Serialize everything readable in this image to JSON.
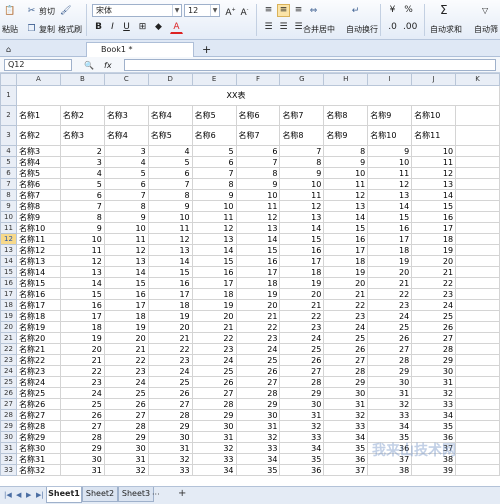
{
  "ribbon": {
    "paste": "粘贴",
    "cut": "剪切",
    "copy": "复制",
    "format_painter": "格式刷",
    "font_name": "宋体",
    "font_size": "12",
    "bold": "B",
    "italic": "I",
    "underline": "U",
    "font_color": "A",
    "merge_center": "合并居中",
    "wrap_text": "自动换行",
    "currency": "¥",
    "percent": "%",
    "autosum": "自动求和",
    "autofilter": "自动筛"
  },
  "tabs": {
    "document": "Book1 *",
    "new_tab": "+"
  },
  "formula_bar": {
    "name_box": "Q12",
    "fx": "fx",
    "formula": ""
  },
  "columns": [
    "A",
    "B",
    "C",
    "D",
    "E",
    "F",
    "G",
    "H",
    "I",
    "J",
    "K"
  ],
  "selected_row": 12,
  "title": "XX表",
  "header_row_2": [
    "名称1",
    "名称2",
    "名称3",
    "名称4",
    "名称5",
    "名称6",
    "名称7",
    "名称8",
    "名称9",
    "名称10"
  ],
  "header_row_3": [
    "名称2",
    "名称3",
    "名称4",
    "名称5",
    "名称6",
    "名称7",
    "名称8",
    "名称9",
    "名称10",
    "名称11"
  ],
  "data_rows": [
    {
      "label": "名称3",
      "values": [
        2,
        3,
        4,
        5,
        6,
        7,
        8,
        9,
        10
      ]
    },
    {
      "label": "名称4",
      "values": [
        3,
        4,
        5,
        6,
        7,
        8,
        9,
        10,
        11
      ]
    },
    {
      "label": "名称5",
      "values": [
        4,
        5,
        6,
        7,
        8,
        9,
        10,
        11,
        12
      ]
    },
    {
      "label": "名称6",
      "values": [
        5,
        6,
        7,
        8,
        9,
        10,
        11,
        12,
        13
      ]
    },
    {
      "label": "名称7",
      "values": [
        6,
        7,
        8,
        9,
        10,
        11,
        12,
        13,
        14
      ]
    },
    {
      "label": "名称8",
      "values": [
        7,
        8,
        9,
        10,
        11,
        12,
        13,
        14,
        15
      ]
    },
    {
      "label": "名称9",
      "values": [
        8,
        9,
        10,
        11,
        12,
        13,
        14,
        15,
        16
      ]
    },
    {
      "label": "名称10",
      "values": [
        9,
        10,
        11,
        12,
        13,
        14,
        15,
        16,
        17
      ]
    },
    {
      "label": "名称11",
      "values": [
        10,
        11,
        12,
        13,
        14,
        15,
        16,
        17,
        18
      ]
    },
    {
      "label": "名称12",
      "values": [
        11,
        12,
        13,
        14,
        15,
        16,
        17,
        18,
        19
      ]
    },
    {
      "label": "名称13",
      "values": [
        12,
        13,
        14,
        15,
        16,
        17,
        18,
        19,
        20
      ]
    },
    {
      "label": "名称14",
      "values": [
        13,
        14,
        15,
        16,
        17,
        18,
        19,
        20,
        21
      ]
    },
    {
      "label": "名称15",
      "values": [
        14,
        15,
        16,
        17,
        18,
        19,
        20,
        21,
        22
      ]
    },
    {
      "label": "名称16",
      "values": [
        15,
        16,
        17,
        18,
        19,
        20,
        21,
        22,
        23
      ]
    },
    {
      "label": "名称17",
      "values": [
        16,
        17,
        18,
        19,
        20,
        21,
        22,
        23,
        24
      ]
    },
    {
      "label": "名称18",
      "values": [
        17,
        18,
        19,
        20,
        21,
        22,
        23,
        24,
        25
      ]
    },
    {
      "label": "名称19",
      "values": [
        18,
        19,
        20,
        21,
        22,
        23,
        24,
        25,
        26
      ]
    },
    {
      "label": "名称20",
      "values": [
        19,
        20,
        21,
        22,
        23,
        24,
        25,
        26,
        27
      ]
    },
    {
      "label": "名称21",
      "values": [
        20,
        21,
        22,
        23,
        24,
        25,
        26,
        27,
        28
      ]
    },
    {
      "label": "名称22",
      "values": [
        21,
        22,
        23,
        24,
        25,
        26,
        27,
        28,
        29
      ]
    },
    {
      "label": "名称23",
      "values": [
        22,
        23,
        24,
        25,
        26,
        27,
        28,
        29,
        30
      ]
    },
    {
      "label": "名称24",
      "values": [
        23,
        24,
        25,
        26,
        27,
        28,
        29,
        30,
        31
      ]
    },
    {
      "label": "名称25",
      "values": [
        24,
        25,
        26,
        27,
        28,
        29,
        30,
        31,
        32
      ]
    },
    {
      "label": "名称26",
      "values": [
        25,
        26,
        27,
        28,
        29,
        30,
        31,
        32,
        33
      ]
    },
    {
      "label": "名称27",
      "values": [
        26,
        27,
        28,
        29,
        30,
        31,
        32,
        33,
        34
      ]
    },
    {
      "label": "名称28",
      "values": [
        27,
        28,
        29,
        30,
        31,
        32,
        33,
        34,
        35
      ]
    },
    {
      "label": "名称29",
      "values": [
        28,
        29,
        30,
        31,
        32,
        33,
        34,
        35,
        36
      ]
    },
    {
      "label": "名称30",
      "values": [
        29,
        30,
        31,
        32,
        33,
        34,
        35,
        36,
        37
      ]
    },
    {
      "label": "名称31",
      "values": [
        30,
        31,
        32,
        33,
        34,
        35,
        36,
        37,
        38
      ]
    },
    {
      "label": "名称32",
      "values": [
        31,
        32,
        33,
        34,
        35,
        36,
        37,
        38,
        39
      ]
    }
  ],
  "sheets": [
    "Sheet1",
    "Sheet2",
    "Sheet3"
  ],
  "active_sheet": "Sheet1",
  "sheet_more": "···",
  "sheet_add": "+",
  "watermark": "我来山技术网"
}
